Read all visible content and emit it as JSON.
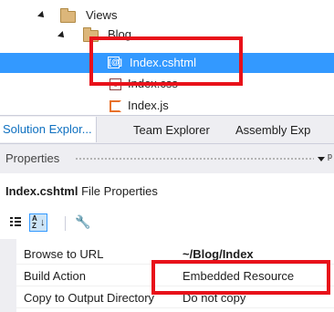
{
  "tree": {
    "items": [
      {
        "label": "Views"
      },
      {
        "label": "Blog"
      },
      {
        "label": "Index.cshtml",
        "icon_text": "[@]"
      },
      {
        "label": "Index.css"
      },
      {
        "label": "Index.js"
      }
    ]
  },
  "tabs": [
    {
      "label": "Solution Explor..."
    },
    {
      "label": "Team Explorer"
    },
    {
      "label": "Assembly Exp"
    }
  ],
  "properties": {
    "title": "Properties",
    "pin_glyph": "p",
    "object_name": "Index.cshtml",
    "object_type": "File Properties",
    "rows": [
      {
        "name": "Browse to URL",
        "value": "~/Blog/Index"
      },
      {
        "name": "Build Action",
        "value": "Embedded Resource"
      },
      {
        "name": "Copy to Output Directory",
        "value": "Do not copy"
      }
    ]
  },
  "colors": {
    "selection": "#3399ff",
    "annotation": "#e8111a",
    "active_tab_text": "#0e70c0"
  },
  "icons": [
    "expanded-arrow-icon",
    "folder-icon",
    "razor-file-icon",
    "css-file-icon",
    "js-file-icon",
    "categorized-icon",
    "alphabetical-icon",
    "property-pages-icon",
    "dropdown-icon",
    "pin-icon"
  ]
}
